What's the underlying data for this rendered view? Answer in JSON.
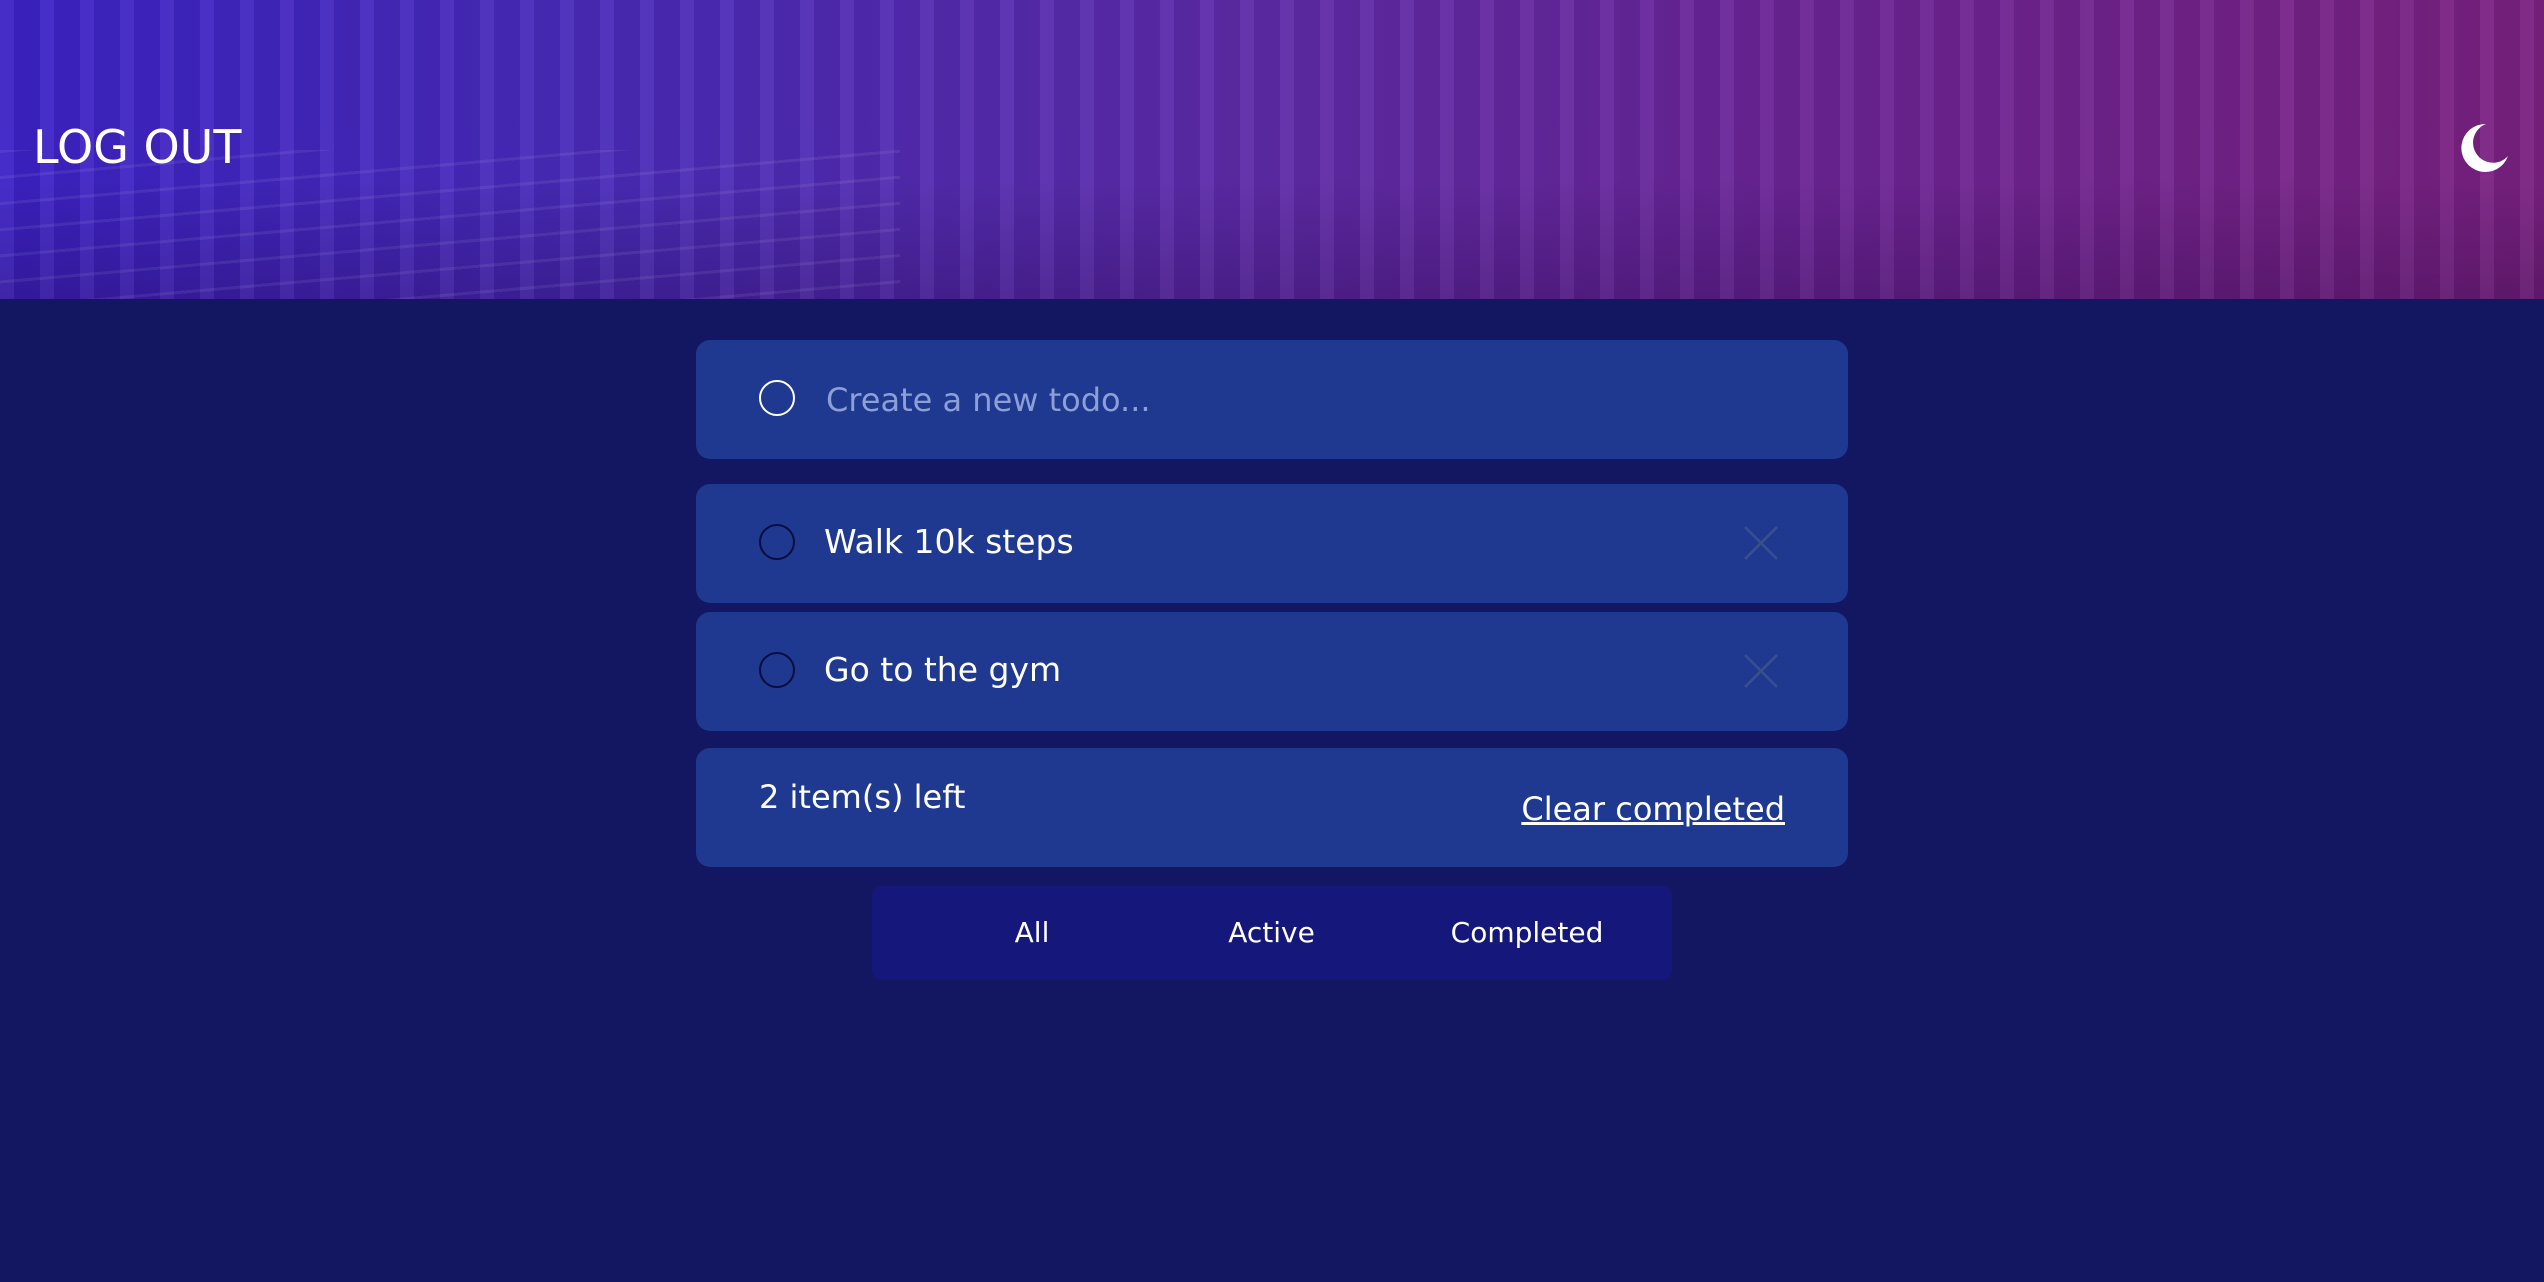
{
  "header": {
    "logout_label": "LOG OUT",
    "theme_icon": "moon-icon"
  },
  "new_todo": {
    "placeholder": "Create a new todo..."
  },
  "todos": [
    {
      "text": "Walk 10k steps",
      "completed": false
    },
    {
      "text": "Go to the gym",
      "completed": false
    }
  ],
  "footer": {
    "items_left": "2 item(s) left",
    "clear_label": "Clear completed"
  },
  "filters": [
    {
      "label": "All"
    },
    {
      "label": "Active"
    },
    {
      "label": "Completed"
    }
  ],
  "colors": {
    "background": "#131660",
    "card": "#1e398f",
    "filter_bar": "#15187a",
    "hero_gradient_start": "#3c22c6",
    "hero_gradient_end": "#7a2180"
  }
}
